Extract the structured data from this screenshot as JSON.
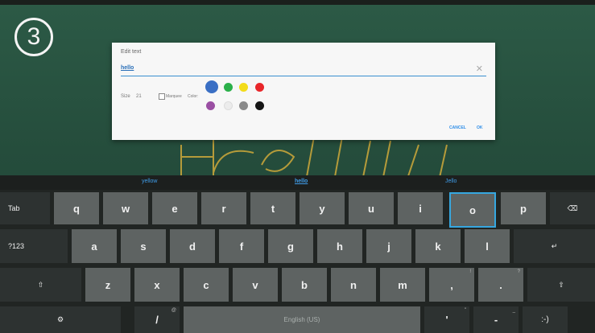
{
  "overlay": {
    "step_number": "3"
  },
  "dialog": {
    "title": "Edit text",
    "input_value": "hello",
    "clear_icon": "close-icon",
    "size_label": "Size",
    "size_value": "21",
    "marquee_label": "Marquee",
    "color_label": "Color:",
    "colors": [
      "#3a6fc4",
      "#2bb04a",
      "#f3dc1a",
      "#e8262a",
      "#9a4fa3",
      "#ececec",
      "#8a8a8a",
      "#151515"
    ],
    "cancel_label": "CANCEL",
    "ok_label": "OK"
  },
  "keyboard": {
    "suggestions": [
      "yellow",
      "hello",
      "Jello"
    ],
    "row1": [
      "Tab",
      "q",
      "w",
      "e",
      "r",
      "t",
      "y",
      "u",
      "i",
      "o",
      "p",
      "⌫"
    ],
    "row2": [
      "?123",
      "a",
      "s",
      "d",
      "f",
      "g",
      "h",
      "j",
      "k",
      "l",
      "↵"
    ],
    "row3": [
      "⇧",
      "z",
      "x",
      "c",
      "v",
      "b",
      "n",
      "m",
      ",",
      ".",
      "⇧"
    ],
    "row3_hints": {
      "comma": "!",
      "period": "?"
    },
    "row4": [
      "⚙",
      "/",
      "English (US)",
      "'",
      "-",
      ":-)"
    ],
    "row4_hints": {
      "slash": "@",
      "apostrophe": "\"",
      "dash": "_"
    },
    "focused_key": "o"
  }
}
